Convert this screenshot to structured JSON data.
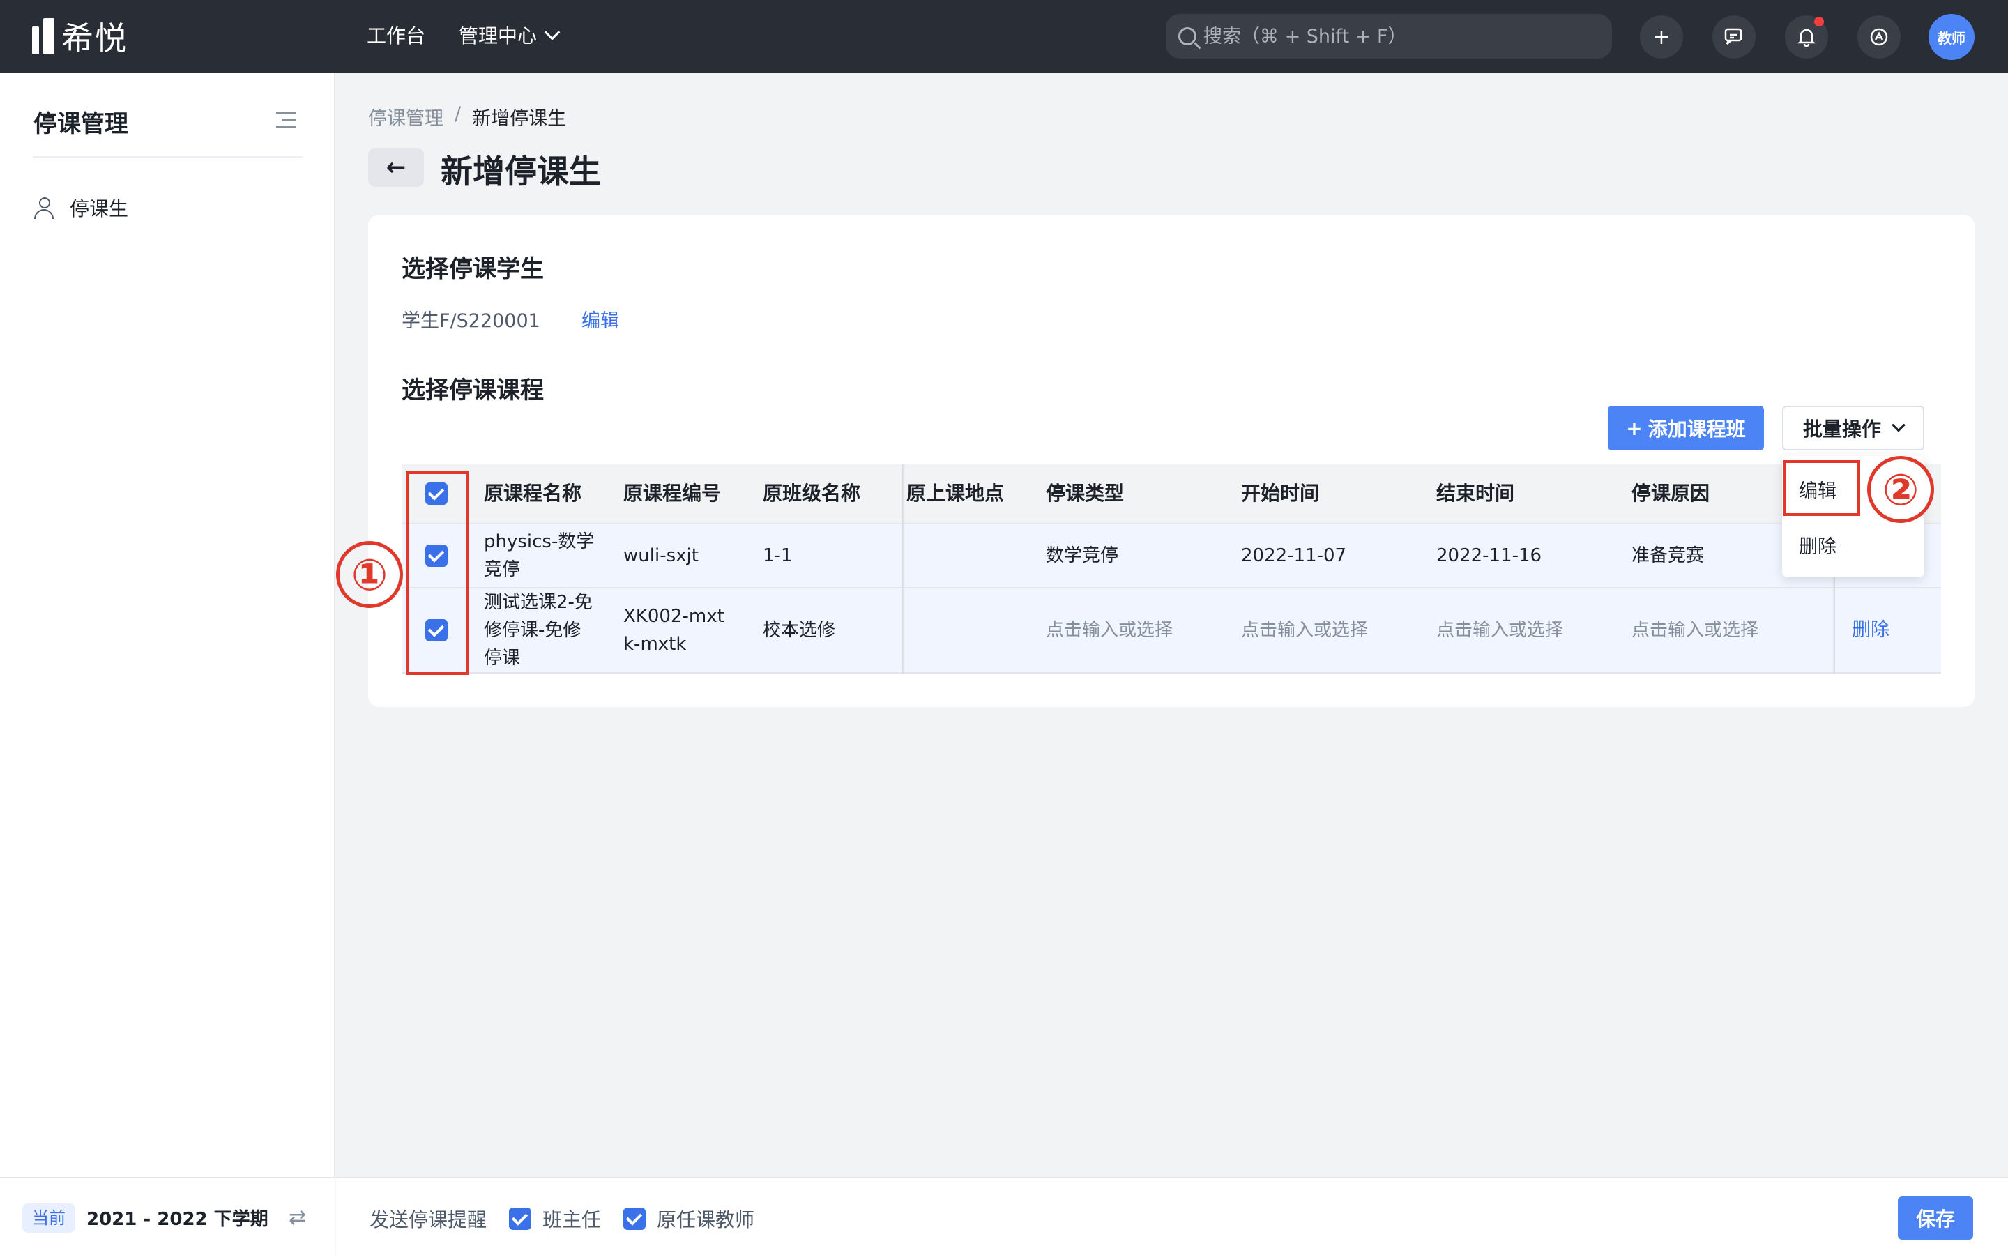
{
  "header": {
    "logo_text": "希悦",
    "nav": {
      "workbench": "工作台",
      "admin_center": "管理中心"
    },
    "search_placeholder": "搜索（⌘ + Shift + F）",
    "icons": [
      "plus-icon",
      "message-icon",
      "bell-icon",
      "switch-icon"
    ],
    "avatar_label": "教师"
  },
  "sidebar": {
    "title": "停课管理",
    "items": [
      {
        "label": "停课生",
        "icon": "user-icon"
      }
    ],
    "footer": {
      "tag": "当前",
      "term": "2021 - 2022 下学期"
    }
  },
  "breadcrumb": {
    "parent": "停课管理",
    "separator": "/",
    "current": "新增停课生"
  },
  "page_title": "新增停课生",
  "student_section": {
    "title": "选择停课学生",
    "student": "学生F/S220001",
    "edit_label": "编辑"
  },
  "course_section": {
    "title": "选择停课课程",
    "add_button": "添加课程班",
    "batch_button": "批量操作",
    "batch_menu": [
      "编辑",
      "删除"
    ],
    "columns": [
      "原课程名称",
      "原课程编号",
      "原班级名称",
      "原上课地点",
      "停课类型",
      "开始时间",
      "结束时间",
      "停课原因"
    ],
    "rows": [
      {
        "checked": true,
        "course_name": "physics-数学竞停",
        "course_code": "wuli-sxjt",
        "class_name": "1-1",
        "location": "",
        "type": "数学竞停",
        "start": "2022-11-07",
        "end": "2022-11-16",
        "reason": "准备竞赛",
        "action": ""
      },
      {
        "checked": true,
        "course_name": "测试选课2-免修停课-免修停课",
        "course_code": "XK002-mxtk-mxtk",
        "class_name": "校本选修",
        "location": "",
        "type": "点击输入或选择",
        "start": "点击输入或选择",
        "end": "点击输入或选择",
        "reason": "点击输入或选择",
        "action": "删除"
      }
    ]
  },
  "annotations": {
    "marker1": "①",
    "marker2": "②"
  },
  "footer": {
    "notify_label": "发送停课提醒",
    "option1": "班主任",
    "option2": "原任课教师",
    "save": "保存"
  },
  "colors": {
    "primary": "#4d84f5",
    "link": "#3b71e8",
    "annotation": "#e0382b",
    "topbar": "#292d35"
  }
}
